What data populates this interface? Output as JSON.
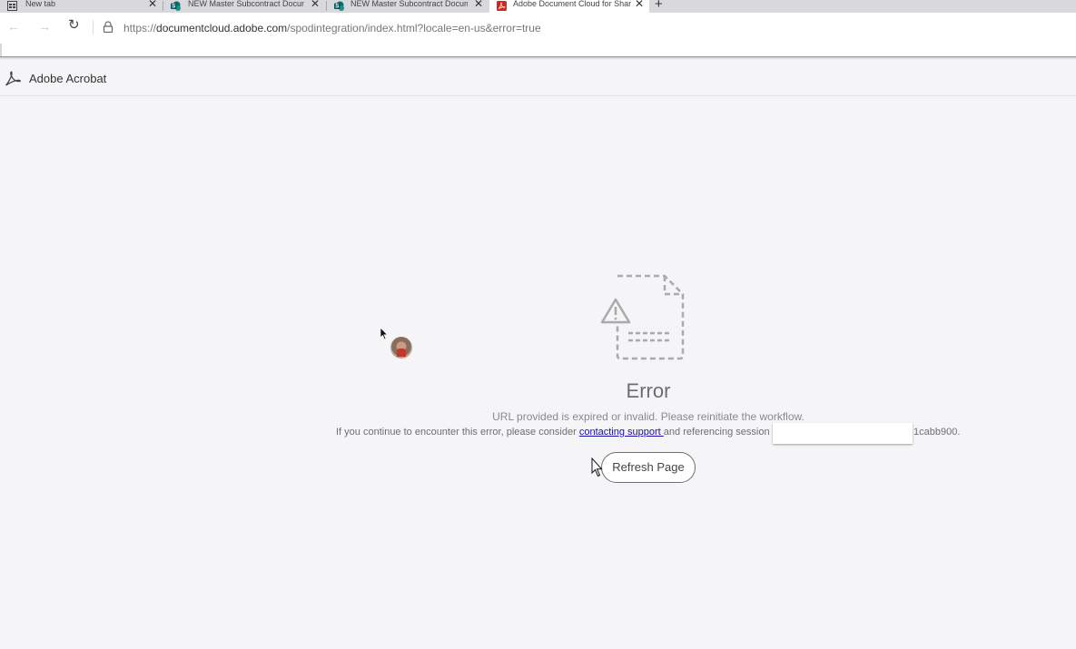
{
  "browser": {
    "tabs": [
      {
        "title": "New tab",
        "icon": "newtab-grid-icon",
        "active": false
      },
      {
        "title": "NEW Master Subcontract Docum",
        "icon": "sharepoint-icon",
        "active": false
      },
      {
        "title": "NEW Master Subcontract Docum",
        "icon": "sharepoint-icon",
        "active": false
      },
      {
        "title": "Adobe Document Cloud for Shar",
        "icon": "adobe-pdf-icon",
        "active": true
      }
    ],
    "close_glyph": "✕",
    "new_tab_glyph": "+",
    "back_glyph": "←",
    "forward_glyph": "→",
    "refresh_glyph": "↻",
    "url_scheme": "https://",
    "url_host": "documentcloud.adobe.com",
    "url_path": "/spodintegration/index.html?locale=en-us&error=true"
  },
  "app": {
    "title": "Adobe Acrobat"
  },
  "error": {
    "title": "Error",
    "message": "URL provided is expired or invalid. Please reinitiate the workflow.",
    "help_prefix": "If you continue to encounter this error, please consider ",
    "help_link": "contacting support ",
    "help_suffix": "and referencing session ",
    "session_tail": "1cabb900.",
    "refresh_label": "Refresh Page"
  },
  "colors": {
    "background": "#f5f4f7",
    "link": "#1a0dab",
    "icon_gray": "#aaaaaa"
  }
}
